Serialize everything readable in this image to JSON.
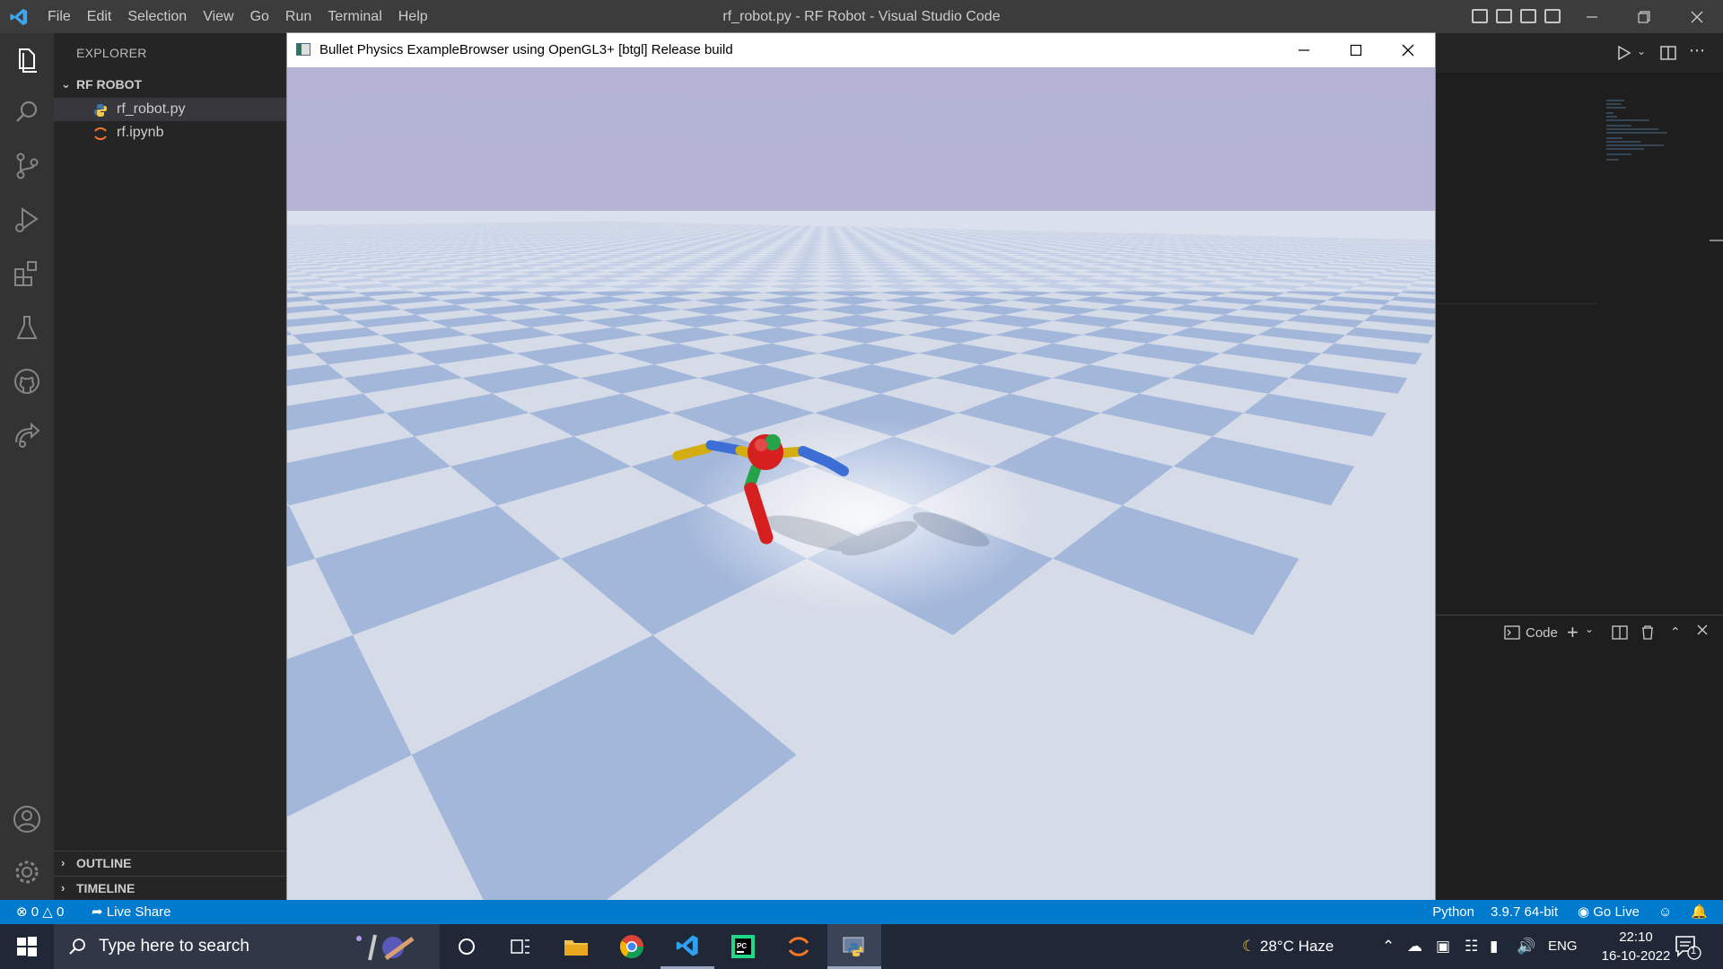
{
  "vscode": {
    "window_title": "rf_robot.py - RF Robot - Visual Studio Code",
    "menu": [
      "File",
      "Edit",
      "Selection",
      "View",
      "Go",
      "Run",
      "Terminal",
      "Help"
    ]
  },
  "sidebar": {
    "title": "EXPLORER",
    "folder": "RF ROBOT",
    "files": [
      {
        "name": "rf_robot.py",
        "icon": "python-file-icon",
        "selected": true
      },
      {
        "name": "rf.ipynb",
        "icon": "jupyter-file-icon",
        "selected": false
      }
    ],
    "outline": "OUTLINE",
    "timeline": "TIMELINE"
  },
  "panel": {
    "terminal_label": "Code"
  },
  "bullet": {
    "title": "Bullet Physics ExampleBrowser using OpenGL3+ [btgl] Release build"
  },
  "statusbar": {
    "errors": "0",
    "warnings": "0",
    "live_share": "Live Share",
    "language": "Python",
    "interpreter": "3.9.7 64-bit",
    "go_live": "Go Live"
  },
  "taskbar": {
    "search_placeholder": "Type here to search",
    "weather": "28°C  Haze",
    "language": "ENG",
    "time": "22:10",
    "date": "16-10-2022",
    "notifications": "1"
  },
  "colors": {
    "accent": "#007acc",
    "titlebar": "#3c3c3c",
    "sidebar": "#252526",
    "activitybar": "#333333",
    "floor_blue": "#a3b7db",
    "floor_white": "#e9ebf0",
    "sky": "#b6b6d5"
  }
}
